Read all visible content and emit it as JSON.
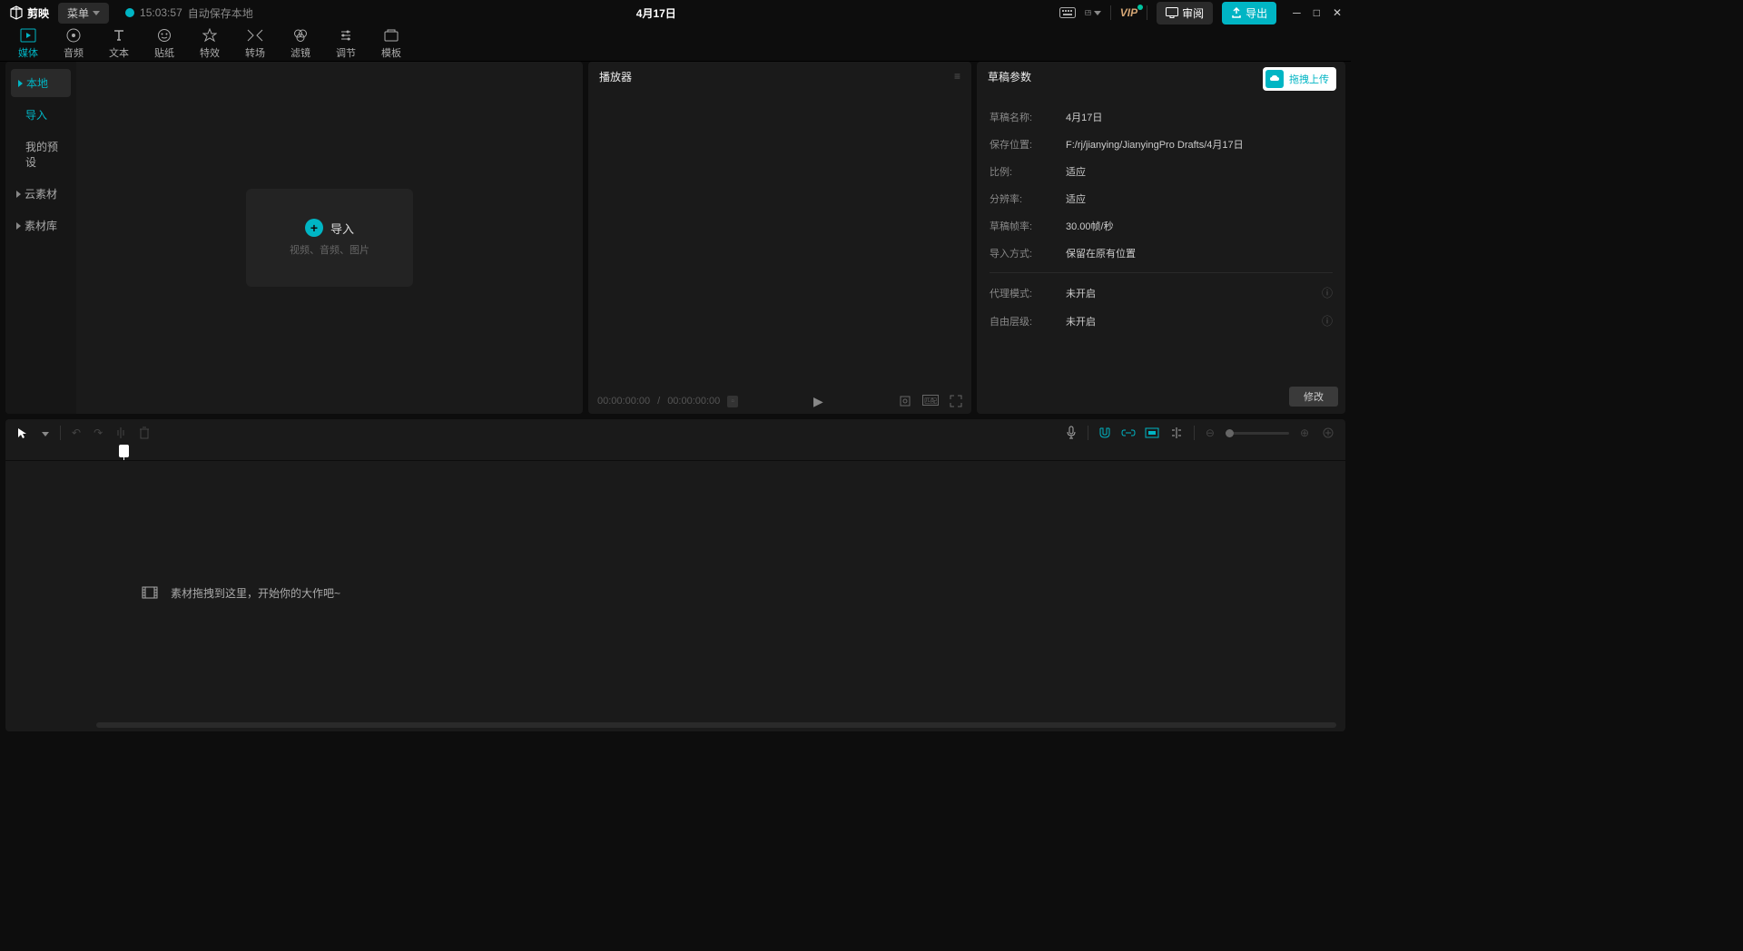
{
  "titlebar": {
    "app_name": "剪映",
    "menu": "菜单",
    "save_time": "15:03:57",
    "save_text": "自动保存本地",
    "title": "4月17日",
    "vip": "VIP",
    "review": "审阅",
    "export": "导出"
  },
  "tabs": [
    {
      "label": "媒体",
      "active": true
    },
    {
      "label": "音频",
      "active": false
    },
    {
      "label": "文本",
      "active": false
    },
    {
      "label": "贴纸",
      "active": false
    },
    {
      "label": "特效",
      "active": false
    },
    {
      "label": "转场",
      "active": false
    },
    {
      "label": "滤镜",
      "active": false
    },
    {
      "label": "调节",
      "active": false
    },
    {
      "label": "模板",
      "active": false
    }
  ],
  "sidebar": {
    "local": "本地",
    "import": "导入",
    "presets": "我的预设",
    "cloud": "云素材",
    "library": "素材库"
  },
  "import_card": {
    "title": "导入",
    "sub": "视频、音频、图片"
  },
  "player": {
    "title": "播放器",
    "time_current": "00:00:00:00",
    "time_sep": "/",
    "time_total": "00:00:00:00"
  },
  "params": {
    "title": "草稿参数",
    "upload": "拖拽上传",
    "rows": [
      {
        "label": "草稿名称:",
        "value": "4月17日"
      },
      {
        "label": "保存位置:",
        "value": "F:/rj/jianying/JianyingPro Drafts/4月17日"
      },
      {
        "label": "比例:",
        "value": "适应"
      },
      {
        "label": "分辨率:",
        "value": "适应"
      },
      {
        "label": "草稿帧率:",
        "value": "30.00帧/秒"
      },
      {
        "label": "导入方式:",
        "value": "保留在原有位置"
      }
    ],
    "rows2": [
      {
        "label": "代理模式:",
        "value": "未开启"
      },
      {
        "label": "自由层级:",
        "value": "未开启"
      }
    ],
    "modify": "修改"
  },
  "timeline": {
    "hint": "素材拖拽到这里，开始你的大作吧~"
  }
}
